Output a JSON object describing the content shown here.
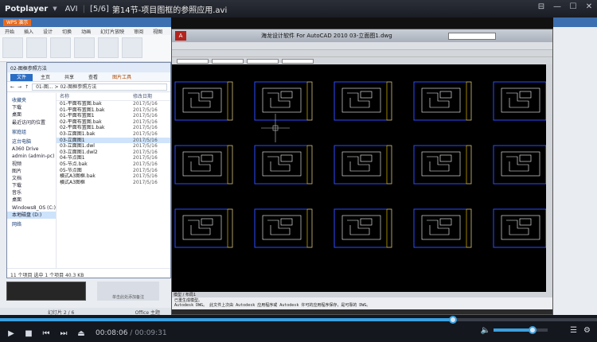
{
  "player": {
    "brand": "Potplayer",
    "format": "AVI",
    "playlist_pos": "[5/6]",
    "file_title": "第14节-项目图框的参照应用.avi",
    "window_buttons": [
      "pin-icon",
      "minimize-icon",
      "maximize-icon",
      "close-icon"
    ]
  },
  "wps": {
    "tab_label": "WPS 演示",
    "menu": [
      "开始",
      "插入",
      "设计",
      "切换",
      "动画",
      "幻灯片放映",
      "审阅",
      "视图"
    ],
    "thumb_caption": "单击此处添加备注",
    "footer_left": "幻灯片 2 / 6",
    "footer_right": "Office 主题"
  },
  "explorer": {
    "title": "02-图框参照方法",
    "tabs": [
      "文件",
      "主页",
      "共享",
      "查看"
    ],
    "context_tab": "图片工具",
    "breadcrumb": "01-图... > 02-图框参照方法",
    "nav": [
      {
        "label": "收藏夹",
        "group": true
      },
      {
        "label": "下载"
      },
      {
        "label": "桌面"
      },
      {
        "label": "最近访问的位置"
      },
      {
        "label": "家庭组",
        "group": true
      },
      {
        "label": "这台电脑",
        "group": true
      },
      {
        "label": "A360 Drive"
      },
      {
        "label": "admin (admin-pc)"
      },
      {
        "label": "视频"
      },
      {
        "label": "图片"
      },
      {
        "label": "文档"
      },
      {
        "label": "下载"
      },
      {
        "label": "音乐"
      },
      {
        "label": "桌面"
      },
      {
        "label": "Windows8_OS (C:)"
      },
      {
        "label": "本地磁盘 (D:)",
        "selected": true
      },
      {
        "label": "网络",
        "group": true
      }
    ],
    "columns": [
      "名称",
      "修改日期"
    ],
    "files": [
      {
        "name": "01-平面布置图.bak",
        "date": "2017/5/16"
      },
      {
        "name": "01-平面布置图1.bak",
        "date": "2017/5/16"
      },
      {
        "name": "01-平面布置图1",
        "date": "2017/5/16"
      },
      {
        "name": "02-平面布置图.bak",
        "date": "2017/5/16"
      },
      {
        "name": "02-平面布置图1.bak",
        "date": "2017/5/16"
      },
      {
        "name": "03-立面图1.bak",
        "date": "2017/5/16"
      },
      {
        "name": "03-立面图1",
        "date": "2017/5/16",
        "selected": true
      },
      {
        "name": "03-立面图1.dwl",
        "date": "2017/5/16"
      },
      {
        "name": "03-立面图1.dwl2",
        "date": "2017/5/16"
      },
      {
        "name": "04-节点图1",
        "date": "2017/5/16"
      },
      {
        "name": "05-节点.bak",
        "date": "2017/5/16"
      },
      {
        "name": "05-节点图",
        "date": "2017/5/16"
      },
      {
        "name": "横式A3图框.bak",
        "date": "2017/5/16"
      },
      {
        "name": "横式A3图框",
        "date": "2017/5/16"
      }
    ],
    "status": "11 个项目    选中 1 个项目  40.3 KB"
  },
  "cad": {
    "title": "海龙设计软件 For AutoCAD 2010     03-立面图1.dwg",
    "layout_tabs": "模型 / 布局1",
    "command_lines": [
      "已重生成模型。",
      "Autodesk DWG。 此文件上次由 Autodesk 应用程序或 Autodesk 许可的应用程序保存，是可靠的 DWG。"
    ]
  },
  "controls": {
    "time_current": "00:08:06",
    "time_total": "00:09:31",
    "progress": 0.758,
    "volume": 0.72
  },
  "colors": {
    "accent": "#3aa0e0",
    "cad_frame": "#2b4cff",
    "cad_lines": "#ffffff"
  }
}
